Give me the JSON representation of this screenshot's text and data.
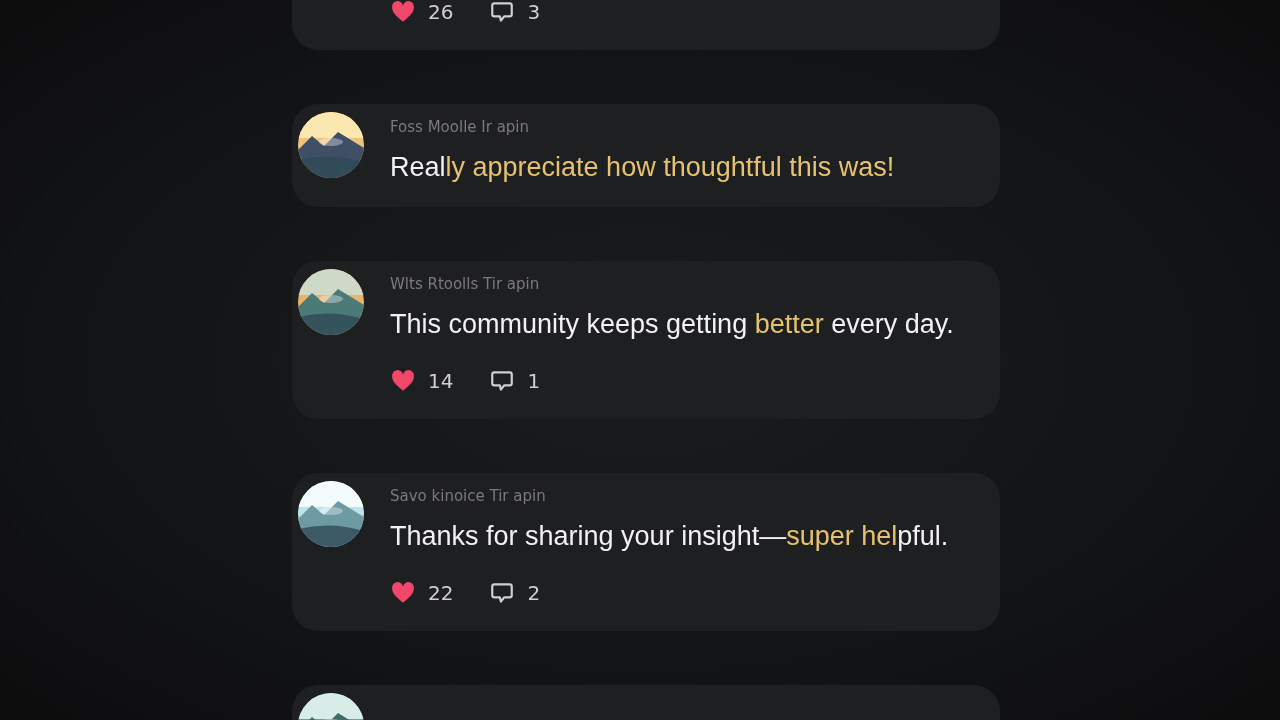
{
  "comments": [
    {
      "likes": "26",
      "replies": "3"
    },
    {
      "avatar": {
        "kind": "picture"
      },
      "author": "Foss Moolle Ir apin",
      "text": [
        {
          "text": "Real",
          "highlight": false
        },
        {
          "text": "ly appreciate how thoughtful this was!",
          "highlight": true
        }
      ]
    },
    {
      "avatar": {
        "kind": "picture"
      },
      "author": "Wlts Rtoolls Tir apin",
      "text": [
        {
          "text": "This community keeps getting ",
          "highlight": false
        },
        {
          "text": "better",
          "highlight": true
        },
        {
          "text": " every day.",
          "highlight": false
        }
      ],
      "likes": "14",
      "replies": "1"
    },
    {
      "avatar": {
        "kind": "picture"
      },
      "author": "Savo kinoice Tir apin",
      "text": [
        {
          "text": "Thanks for sharing your insight—",
          "highlight": false
        },
        {
          "text": "super hel",
          "highlight": true
        },
        {
          "text": "pful.",
          "highlight": false
        }
      ],
      "likes": "22",
      "replies": "2"
    },
    {
      "avatar": {
        "kind": "picture"
      }
    }
  ]
}
